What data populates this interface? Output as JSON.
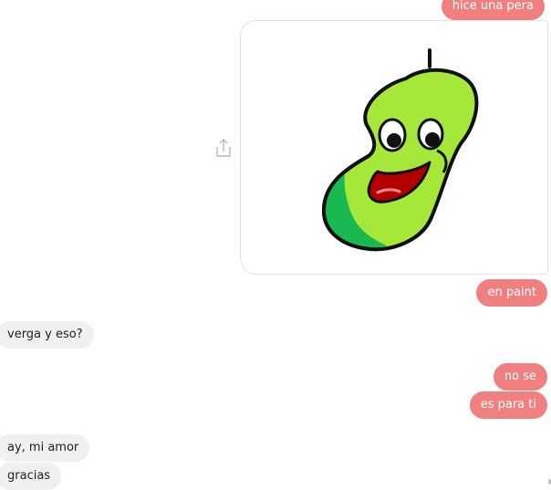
{
  "conversation": {
    "messages": [
      {
        "direction": "outgoing",
        "text": "hice una pera"
      },
      {
        "direction": "outgoing",
        "type": "image",
        "image_label": "pear-drawing-image"
      },
      {
        "direction": "outgoing",
        "text": "en paint"
      },
      {
        "direction": "incoming",
        "text": "verga y eso?"
      },
      {
        "direction": "outgoing",
        "text": "no se"
      },
      {
        "direction": "outgoing",
        "text": "es para ti"
      },
      {
        "direction": "incoming",
        "text": "ay, mi amor"
      },
      {
        "direction": "incoming",
        "text": "gracias"
      }
    ]
  },
  "share_action": {
    "icon": "share-icon"
  },
  "colors": {
    "outgoing_bubble": "#f08080",
    "incoming_bubble": "#f1f0f0",
    "pear_body": "#a6e83a",
    "pear_shadow": "#1ab850",
    "mouth": "#b30000"
  }
}
